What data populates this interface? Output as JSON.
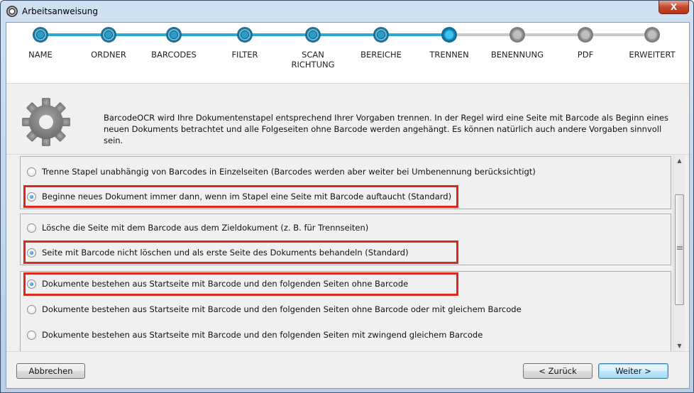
{
  "window": {
    "title": "Arbeitsanweisung",
    "close_label": "X"
  },
  "steps": [
    {
      "label": "NAME",
      "state": "done"
    },
    {
      "label": "ORDNER",
      "state": "done"
    },
    {
      "label": "BARCODES",
      "state": "done"
    },
    {
      "label": "FILTER",
      "state": "done"
    },
    {
      "label": "SCAN\nRICHTUNG",
      "state": "done"
    },
    {
      "label": "BEREICHE",
      "state": "done"
    },
    {
      "label": "TRENNEN",
      "state": "current"
    },
    {
      "label": "BENENNUNG",
      "state": "todo"
    },
    {
      "label": "PDF",
      "state": "todo"
    },
    {
      "label": "ERWEITERT",
      "state": "todo"
    }
  ],
  "info": {
    "icon": "gear-icon",
    "text": "BarcodeOCR wird Ihre Dokumentenstapel entsprechend Ihrer Vorgaben trennen. In der Regel wird eine Seite mit Barcode als Beginn eines neuen Dokuments betrachtet und alle Folgeseiten ohne Barcode werden angehängt. Es können natürlich auch andere Vorgaben sinnvoll sein."
  },
  "groups": [
    {
      "options": [
        {
          "label": "Trenne Stapel unabhängig von Barcodes in Einzelseiten (Barcodes werden aber weiter bei Umbenennung berücksichtigt)",
          "checked": false
        },
        {
          "label": "Beginne neues Dokument immer dann, wenn im Stapel eine Seite mit Barcode auftaucht (Standard)",
          "checked": true
        }
      ]
    },
    {
      "options": [
        {
          "label": "Lösche die Seite mit dem Barcode aus dem Zieldokument (z. B. für Trennseiten)",
          "checked": false
        },
        {
          "label": "Seite mit Barcode nicht löschen und als erste Seite des Dokuments behandeln (Standard)",
          "checked": true
        }
      ]
    },
    {
      "options": [
        {
          "label": "Dokumente bestehen aus Startseite mit Barcode und den folgenden Seiten ohne Barcode",
          "checked": true
        },
        {
          "label": "Dokumente bestehen aus Startseite mit Barcode und den folgenden Seiten ohne Barcode oder mit gleichem Barcode",
          "checked": false
        },
        {
          "label": "Dokumente bestehen aus Startseite mit Barcode und den folgenden Seiten mit zwingend gleichem Barcode",
          "checked": false
        }
      ]
    }
  ],
  "footer": {
    "cancel_label": "Abbrechen",
    "back_label": "< Zurück",
    "next_label": "Weiter >"
  },
  "colors": {
    "highlight": "#e0281a",
    "accent": "#2aa8d8"
  }
}
